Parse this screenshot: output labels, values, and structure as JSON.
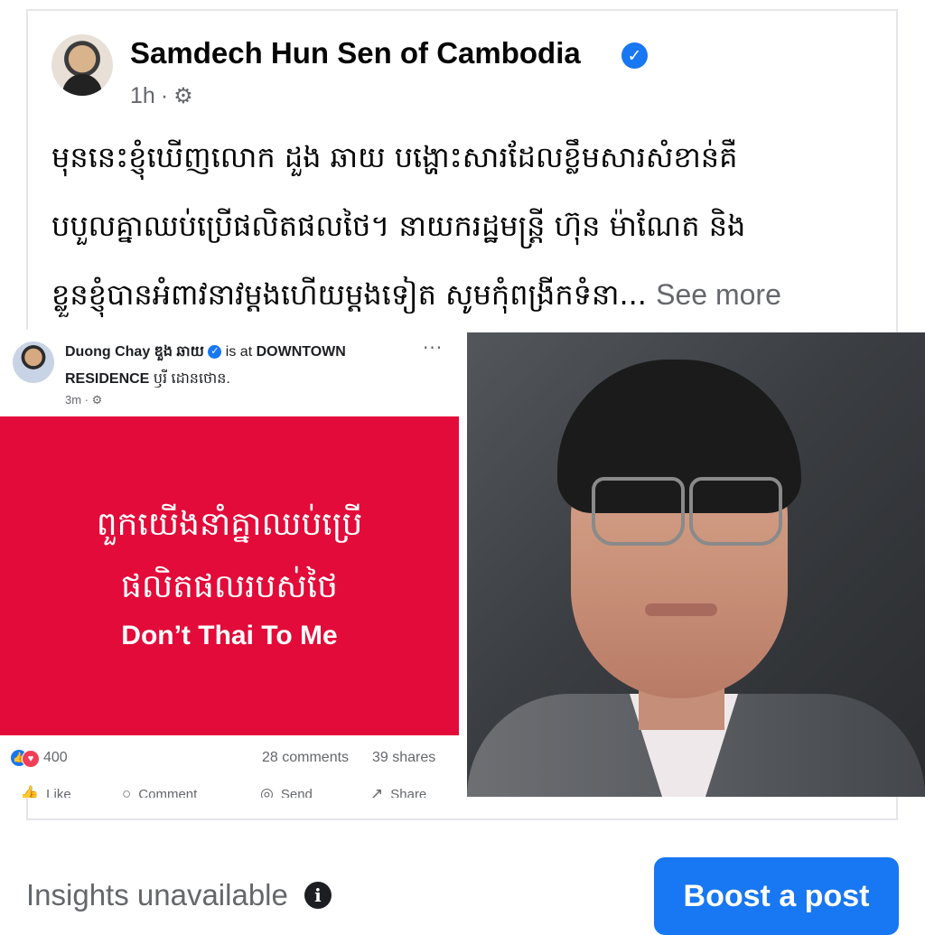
{
  "post": {
    "page_name": "Samdech Hun Sen of Cambodia",
    "time": "1h",
    "separator": "·",
    "text_lines": [
      "មុននេះខ្ញុំឃើញលោក ដួង ឆាយ បង្ហោះសារដែលខ្លឹមសារសំខាន់គឺ",
      "បបួលគ្នាឈប់ប្រើផលិតផលថៃ។ នាយករដ្ឋមន្ត្រី ហ៊ុន ម៉ាណែត និង",
      "ខ្លួនខ្ញុំបានអំពាវនាវម្តងហើយម្តងទៀត សូមកុំពង្រីកទំនា..."
    ],
    "see_more": "See more"
  },
  "embed": {
    "author": "Duong Chay ឌួង ឆាយ",
    "checkin_text": "is at",
    "location": "DOWNTOWN RESIDENCE",
    "location_suffix": "ឫរី ដោនថោន.",
    "time": "3m",
    "more": "···",
    "banner": {
      "line1": "ពួកយើងនាំគ្នាឈប់ប្រើ",
      "line2": "ផលិតផលរបស់ថៃ",
      "line3": "Don’t Thai To Me",
      "color": "#e30b39"
    },
    "reactions": "400",
    "comments": "28 comments",
    "shares": "39 shares",
    "actions": [
      "Like",
      "Comment",
      "Send",
      "Share"
    ]
  },
  "footer": {
    "insights": "Insights unavailable",
    "info_icon": "i",
    "boost": "Boost a post"
  },
  "colors": {
    "accent": "#1877f2",
    "secondary_text": "#65676b",
    "banner_red": "#e30b39"
  }
}
